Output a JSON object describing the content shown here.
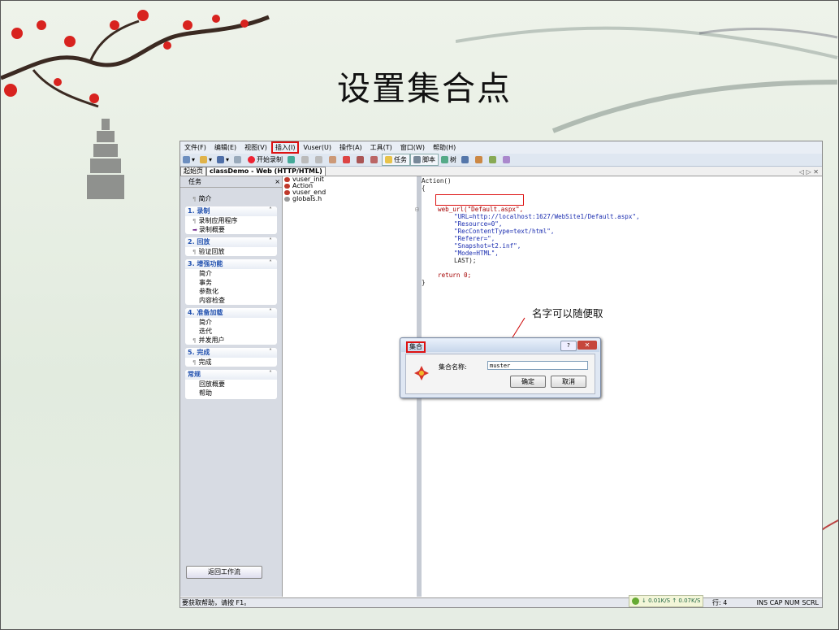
{
  "slide": {
    "title": "设置集合点"
  },
  "menu": [
    "文件(F)",
    "编辑(E)",
    "视图(V)",
    "插入(I)",
    "Vuser(U)",
    "操作(A)",
    "工具(T)",
    "窗口(W)",
    "帮助(H)"
  ],
  "toolbar": {
    "record": "开始录制",
    "tasks": "任务",
    "script": "脚本",
    "tree": "树"
  },
  "tabs": {
    "start": "起始页",
    "doc": "classDemo - Web (HTTP/HTML)",
    "controls": "◁ ▷ ✕"
  },
  "tasks": {
    "header": "任务",
    "close": "×",
    "intro": "简介",
    "groups": [
      {
        "title": "1. 录制",
        "items": [
          "录制应用程序",
          "录制概要"
        ]
      },
      {
        "title": "2. 回放",
        "items": [
          "验证回放"
        ]
      },
      {
        "title": "3. 增强功能",
        "items": [
          "简介",
          "事务",
          "参数化",
          "内容检查"
        ]
      },
      {
        "title": "4. 准备加载",
        "items": [
          "简介",
          "迭代",
          "并发用户"
        ]
      },
      {
        "title": "5. 完成",
        "items": [
          "完成"
        ]
      },
      {
        "title": "常规",
        "items": [
          "回放概要",
          "帮助"
        ]
      }
    ],
    "back": "返回工作流"
  },
  "tree": [
    "vuser_init",
    "Action",
    "vuser_end",
    "globals.h"
  ],
  "code": {
    "l1": "Action()",
    "l2": "{",
    "l3": "web_url(\"Default.aspx\",",
    "l4": "\"URL=http://localhost:1627/WebSite1/Default.aspx\",",
    "l5": "\"Resource=0\",",
    "l6": "\"RecContentType=text/html\",",
    "l7": "\"Referer=\",",
    "l8": "\"Snapshot=t2.inf\",",
    "l9": "\"Mode=HTML\",",
    "l10": "LAST);",
    "l11": "return 0;",
    "l12": "}"
  },
  "annotation": "名字可以随便取",
  "dialog": {
    "title": "集合",
    "help": "?",
    "close": "✕",
    "label": "集合名称:",
    "value": "muster",
    "ok": "确定",
    "cancel": "取消"
  },
  "status": {
    "help": "要获取帮助，请按 F1。",
    "down": "↓ 0.01K/S",
    "up": "↑ 0.07K/S",
    "line": "行: 4",
    "indicators": "INS  CAP  NUM  SCRL"
  }
}
